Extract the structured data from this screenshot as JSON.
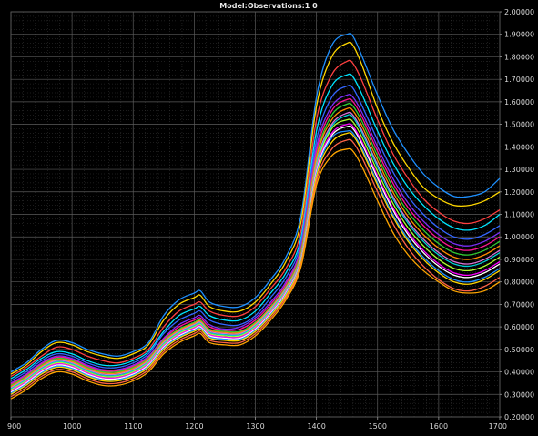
{
  "chart_data": {
    "type": "line",
    "title": "Model:Observations:1 0",
    "xlabel": "",
    "ylabel": "",
    "xlim": [
      900,
      1700
    ],
    "ylim": [
      0.2,
      2.0
    ],
    "x_ticks": [
      "900",
      "1000",
      "1100",
      "1200",
      "1300",
      "1400",
      "1500",
      "1600",
      "1700"
    ],
    "y_ticks": [
      "0.20000",
      "0.30000",
      "0.40000",
      "0.50000",
      "0.60000",
      "0.70000",
      "0.80000",
      "0.90000",
      "1.00000",
      "1.10000",
      "1.20000",
      "1.30000",
      "1.40000",
      "1.50000",
      "1.60000",
      "1.70000",
      "1.80000",
      "1.90000",
      "2.00000"
    ],
    "grid": true,
    "legend": "none",
    "x": [
      900,
      925,
      950,
      975,
      1000,
      1025,
      1050,
      1075,
      1100,
      1125,
      1150,
      1175,
      1200,
      1210,
      1225,
      1250,
      1275,
      1300,
      1325,
      1350,
      1375,
      1400,
      1425,
      1450,
      1460,
      1475,
      1500,
      1525,
      1550,
      1575,
      1600,
      1625,
      1650,
      1675,
      1700
    ],
    "series": [
      {
        "color": "#1e90ff",
        "values": [
          0.4,
          0.44,
          0.5,
          0.54,
          0.53,
          0.5,
          0.48,
          0.47,
          0.49,
          0.53,
          0.65,
          0.72,
          0.75,
          0.76,
          0.71,
          0.69,
          0.69,
          0.73,
          0.81,
          0.91,
          1.1,
          1.62,
          1.85,
          1.9,
          1.89,
          1.8,
          1.63,
          1.48,
          1.37,
          1.28,
          1.22,
          1.18,
          1.18,
          1.2,
          1.26
        ]
      },
      {
        "color": "#ffd700",
        "values": [
          0.39,
          0.43,
          0.49,
          0.53,
          0.52,
          0.49,
          0.47,
          0.46,
          0.48,
          0.52,
          0.63,
          0.7,
          0.73,
          0.74,
          0.69,
          0.67,
          0.67,
          0.71,
          0.79,
          0.89,
          1.07,
          1.58,
          1.8,
          1.86,
          1.85,
          1.76,
          1.57,
          1.42,
          1.31,
          1.22,
          1.17,
          1.14,
          1.14,
          1.16,
          1.2
        ]
      },
      {
        "color": "#ff4040",
        "values": [
          0.38,
          0.42,
          0.47,
          0.51,
          0.5,
          0.47,
          0.45,
          0.44,
          0.46,
          0.5,
          0.6,
          0.67,
          0.7,
          0.71,
          0.67,
          0.65,
          0.65,
          0.69,
          0.77,
          0.86,
          1.03,
          1.52,
          1.72,
          1.78,
          1.77,
          1.69,
          1.52,
          1.37,
          1.26,
          1.17,
          1.11,
          1.07,
          1.06,
          1.08,
          1.12
        ]
      },
      {
        "color": "#00e5ff",
        "values": [
          0.37,
          0.41,
          0.46,
          0.49,
          0.48,
          0.45,
          0.43,
          0.43,
          0.45,
          0.49,
          0.58,
          0.65,
          0.68,
          0.69,
          0.65,
          0.63,
          0.63,
          0.67,
          0.75,
          0.84,
          1.0,
          1.47,
          1.67,
          1.72,
          1.71,
          1.63,
          1.47,
          1.33,
          1.22,
          1.14,
          1.08,
          1.04,
          1.03,
          1.05,
          1.1
        ]
      },
      {
        "color": "#3366ff",
        "values": [
          0.36,
          0.4,
          0.45,
          0.48,
          0.47,
          0.44,
          0.42,
          0.42,
          0.44,
          0.48,
          0.57,
          0.63,
          0.66,
          0.67,
          0.63,
          0.61,
          0.61,
          0.65,
          0.73,
          0.82,
          0.98,
          1.43,
          1.62,
          1.67,
          1.66,
          1.58,
          1.43,
          1.29,
          1.18,
          1.1,
          1.04,
          1.0,
          0.99,
          1.01,
          1.05
        ]
      },
      {
        "color": "#7b2ff7",
        "values": [
          0.35,
          0.39,
          0.44,
          0.47,
          0.46,
          0.43,
          0.41,
          0.41,
          0.43,
          0.47,
          0.55,
          0.61,
          0.64,
          0.65,
          0.61,
          0.59,
          0.6,
          0.64,
          0.71,
          0.8,
          0.96,
          1.4,
          1.58,
          1.63,
          1.62,
          1.55,
          1.4,
          1.26,
          1.15,
          1.07,
          1.01,
          0.97,
          0.96,
          0.98,
          1.02
        ]
      },
      {
        "color": "#ff1493",
        "values": [
          0.345,
          0.385,
          0.435,
          0.465,
          0.455,
          0.425,
          0.405,
          0.405,
          0.425,
          0.465,
          0.545,
          0.6,
          0.63,
          0.64,
          0.6,
          0.585,
          0.59,
          0.63,
          0.7,
          0.79,
          0.95,
          1.38,
          1.56,
          1.61,
          1.6,
          1.53,
          1.38,
          1.24,
          1.13,
          1.05,
          0.99,
          0.95,
          0.94,
          0.96,
          1.0
        ]
      },
      {
        "color": "#32cd32",
        "values": [
          0.34,
          0.38,
          0.43,
          0.46,
          0.45,
          0.42,
          0.4,
          0.4,
          0.42,
          0.46,
          0.54,
          0.59,
          0.62,
          0.63,
          0.59,
          0.58,
          0.58,
          0.62,
          0.69,
          0.78,
          0.94,
          1.36,
          1.54,
          1.59,
          1.58,
          1.51,
          1.36,
          1.22,
          1.11,
          1.03,
          0.97,
          0.93,
          0.92,
          0.94,
          0.98
        ]
      },
      {
        "color": "#ff8c00",
        "values": [
          0.335,
          0.375,
          0.425,
          0.455,
          0.445,
          0.415,
          0.395,
          0.395,
          0.415,
          0.455,
          0.535,
          0.585,
          0.615,
          0.625,
          0.585,
          0.575,
          0.575,
          0.615,
          0.685,
          0.775,
          0.93,
          1.35,
          1.52,
          1.57,
          1.56,
          1.49,
          1.34,
          1.2,
          1.09,
          1.01,
          0.95,
          0.91,
          0.9,
          0.92,
          0.96
        ]
      },
      {
        "color": "#da70d6",
        "values": [
          0.33,
          0.37,
          0.42,
          0.45,
          0.44,
          0.41,
          0.39,
          0.39,
          0.41,
          0.45,
          0.53,
          0.58,
          0.61,
          0.62,
          0.58,
          0.57,
          0.57,
          0.61,
          0.68,
          0.77,
          0.92,
          1.33,
          1.5,
          1.55,
          1.54,
          1.47,
          1.32,
          1.18,
          1.07,
          0.99,
          0.93,
          0.89,
          0.88,
          0.9,
          0.94
        ]
      },
      {
        "color": "#00ced1",
        "values": [
          0.325,
          0.365,
          0.415,
          0.445,
          0.435,
          0.405,
          0.385,
          0.385,
          0.405,
          0.445,
          0.525,
          0.575,
          0.605,
          0.615,
          0.575,
          0.565,
          0.565,
          0.605,
          0.675,
          0.765,
          0.915,
          1.32,
          1.49,
          1.54,
          1.53,
          1.46,
          1.31,
          1.17,
          1.06,
          0.98,
          0.92,
          0.88,
          0.87,
          0.89,
          0.93
        ]
      },
      {
        "color": "#adff2f",
        "values": [
          0.32,
          0.36,
          0.41,
          0.44,
          0.43,
          0.4,
          0.38,
          0.38,
          0.4,
          0.44,
          0.52,
          0.57,
          0.6,
          0.61,
          0.57,
          0.56,
          0.56,
          0.6,
          0.67,
          0.76,
          0.91,
          1.31,
          1.48,
          1.52,
          1.51,
          1.44,
          1.29,
          1.15,
          1.04,
          0.96,
          0.9,
          0.86,
          0.85,
          0.87,
          0.91
        ]
      },
      {
        "color": "#ff00ff",
        "values": [
          0.315,
          0.355,
          0.405,
          0.435,
          0.425,
          0.395,
          0.375,
          0.375,
          0.395,
          0.435,
          0.515,
          0.565,
          0.595,
          0.605,
          0.565,
          0.555,
          0.555,
          0.595,
          0.665,
          0.755,
          0.905,
          1.3,
          1.46,
          1.5,
          1.49,
          1.42,
          1.27,
          1.13,
          1.02,
          0.94,
          0.88,
          0.84,
          0.83,
          0.85,
          0.89
        ]
      },
      {
        "color": "#ffffff",
        "values": [
          0.31,
          0.35,
          0.4,
          0.43,
          0.42,
          0.39,
          0.37,
          0.37,
          0.39,
          0.43,
          0.51,
          0.56,
          0.59,
          0.6,
          0.56,
          0.55,
          0.55,
          0.59,
          0.66,
          0.75,
          0.9,
          1.29,
          1.45,
          1.49,
          1.48,
          1.41,
          1.26,
          1.12,
          1.01,
          0.93,
          0.87,
          0.83,
          0.82,
          0.84,
          0.88
        ]
      },
      {
        "color": "#1e90ff",
        "values": [
          0.305,
          0.345,
          0.395,
          0.425,
          0.415,
          0.385,
          0.365,
          0.365,
          0.385,
          0.425,
          0.505,
          0.555,
          0.585,
          0.595,
          0.555,
          0.545,
          0.545,
          0.585,
          0.655,
          0.745,
          0.895,
          1.28,
          1.44,
          1.47,
          1.46,
          1.39,
          1.24,
          1.1,
          0.99,
          0.91,
          0.85,
          0.81,
          0.8,
          0.82,
          0.86
        ]
      },
      {
        "color": "#ffd700",
        "values": [
          0.3,
          0.34,
          0.39,
          0.42,
          0.41,
          0.38,
          0.36,
          0.36,
          0.38,
          0.42,
          0.5,
          0.55,
          0.58,
          0.59,
          0.55,
          0.54,
          0.54,
          0.58,
          0.65,
          0.74,
          0.89,
          1.27,
          1.42,
          1.46,
          1.45,
          1.38,
          1.23,
          1.09,
          0.98,
          0.9,
          0.84,
          0.8,
          0.79,
          0.81,
          0.85
        ]
      },
      {
        "color": "#ff6347",
        "values": [
          0.29,
          0.33,
          0.38,
          0.41,
          0.4,
          0.37,
          0.35,
          0.35,
          0.37,
          0.41,
          0.49,
          0.54,
          0.57,
          0.58,
          0.54,
          0.53,
          0.53,
          0.57,
          0.64,
          0.73,
          0.88,
          1.25,
          1.39,
          1.43,
          1.42,
          1.35,
          1.2,
          1.06,
          0.95,
          0.87,
          0.81,
          0.77,
          0.76,
          0.78,
          0.82
        ]
      },
      {
        "color": "#ffa500",
        "values": [
          0.28,
          0.32,
          0.37,
          0.4,
          0.39,
          0.36,
          0.34,
          0.34,
          0.36,
          0.4,
          0.48,
          0.53,
          0.56,
          0.57,
          0.53,
          0.52,
          0.52,
          0.56,
          0.63,
          0.72,
          0.87,
          1.23,
          1.36,
          1.39,
          1.38,
          1.31,
          1.16,
          1.02,
          0.92,
          0.85,
          0.8,
          0.76,
          0.75,
          0.76,
          0.8
        ]
      }
    ]
  }
}
